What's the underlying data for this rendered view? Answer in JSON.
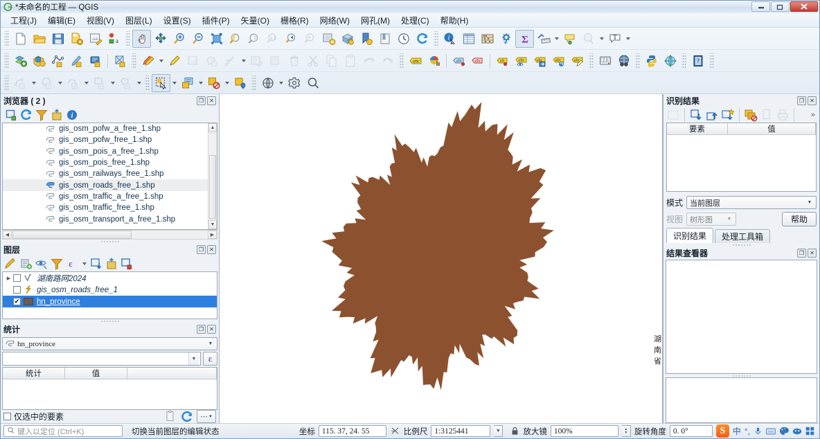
{
  "window": {
    "title": "*未命名的工程 — QGIS",
    "logo_icon": "qgis-logo-icon",
    "minimize_label": "—",
    "restore_label": "❐",
    "close_label": "✕"
  },
  "menubar": {
    "items": [
      {
        "label": "工程(J)",
        "name": "menu-project"
      },
      {
        "label": "编辑(E)",
        "name": "menu-edit"
      },
      {
        "label": "视图(V)",
        "name": "menu-view"
      },
      {
        "label": "图层(L)",
        "name": "menu-layer"
      },
      {
        "label": "设置(S)",
        "name": "menu-settings"
      },
      {
        "label": "插件(P)",
        "name": "menu-plugins"
      },
      {
        "label": "矢量(O)",
        "name": "menu-vector"
      },
      {
        "label": "栅格(R)",
        "name": "menu-raster"
      },
      {
        "label": "网络(W)",
        "name": "menu-web"
      },
      {
        "label": "网孔(M)",
        "name": "menu-mesh"
      },
      {
        "label": "处理(C)",
        "name": "menu-processing"
      },
      {
        "label": "帮助(H)",
        "name": "menu-help"
      }
    ]
  },
  "browser_panel": {
    "title": "浏览器 ( 2 )",
    "toolbar": [
      "collapse-all-icon",
      "refresh-icon",
      "filter-icon",
      "add-layer-icon",
      "info-icon"
    ],
    "items": [
      {
        "label": "gis_osm_pofw_a_free_1.shp",
        "selected": false
      },
      {
        "label": "gis_osm_pofw_free_1.shp",
        "selected": false
      },
      {
        "label": "gis_osm_pois_a_free_1.shp",
        "selected": false
      },
      {
        "label": "gis_osm_pois_free_1.shp",
        "selected": false
      },
      {
        "label": "gis_osm_railways_free_1.shp",
        "selected": false
      },
      {
        "label": "gis_osm_roads_free_1.shp",
        "selected": true
      },
      {
        "label": "gis_osm_traffic_a_free_1.shp",
        "selected": false
      },
      {
        "label": "gis_osm_traffic_free_1.shp",
        "selected": false
      },
      {
        "label": "gis_osm_transport_a_free_1.shp",
        "selected": false
      }
    ]
  },
  "layers_panel": {
    "title": "图层",
    "toolbar": [
      "open-layer-styling-icon",
      "add-group-icon",
      "manage-visibility-icon",
      "filter-legend-icon",
      "expression-filter-icon",
      "expand-all-icon",
      "collapse-all-icon",
      "remove-layer-icon"
    ],
    "layers": [
      {
        "label": "湖南路网2024",
        "checked": false,
        "selected": false,
        "symbol": "line-v-icon",
        "expandable": true
      },
      {
        "label": "gis_osm_roads_free_1",
        "checked": false,
        "selected": false,
        "symbol": "line-zigzag-icon",
        "expandable": false
      },
      {
        "label": "hn_province",
        "checked": true,
        "selected": true,
        "symbol": "polygon-swatch",
        "swatch_color": "#6d5b55",
        "expandable": false
      }
    ]
  },
  "statistics_panel": {
    "title": "统计",
    "layer_value": "hn_province",
    "layer_icon": "polygon-layer-icon",
    "expression_value": "",
    "expression_button_label": "ε",
    "columns": [
      "统计",
      "值"
    ],
    "rows": [],
    "only_selected_label": "仅选中的要素",
    "only_selected_checked": false,
    "footer_icons": [
      "copy-icon",
      "refresh-icon",
      "options-icon"
    ]
  },
  "map": {
    "label": "湖南省",
    "fill_color": "#8c5230",
    "background_color": "#ffffff"
  },
  "identify_panel": {
    "title": "识别结果",
    "toolbar": [
      "expand-new-icon",
      "expand-all-icon",
      "collapse-all-icon",
      "highlight-icon",
      "clear-results-icon",
      "copy-icon",
      "print-icon"
    ],
    "more_label": "»",
    "columns": [
      "要素",
      "值"
    ],
    "rows": [],
    "mode_label": "模式",
    "mode_value": "当前图层",
    "view_label": "视图",
    "view_value": "树形图",
    "help_label": "帮助",
    "tabs": [
      {
        "label": "识别结果",
        "active": true
      },
      {
        "label": "处理工具箱",
        "active": false
      }
    ]
  },
  "results_panel": {
    "title": "结果查看器"
  },
  "statusbar": {
    "locator_placeholder": "键入以定位 (Ctrl+K)",
    "locator_icon": "search-icon",
    "hint": "切换当前图层的编辑状态",
    "coord_label": "坐标",
    "coord_value": "115. 37, 24. 55",
    "toggle_extents_icon": "extents-toggle-icon",
    "scale_label": "比例尺",
    "scale_value": "1:3125441",
    "lock_icon": "lock-icon",
    "magnifier_label": "放大镜",
    "magnifier_value": "100%",
    "rotation_label": "旋转角度",
    "rotation_value": "0. 0°",
    "ime": {
      "logo_label": "S",
      "mode_label": "中",
      "punct_label": "°,",
      "icons": [
        "mic-icon",
        "keyboard-icon",
        "palette-icon",
        "emoji-icon",
        "toolbox-icon"
      ]
    }
  },
  "toolbars": {
    "row1": [
      "new-project-icon",
      "open-project-icon",
      "save-project-icon",
      "save-project-as-icon",
      "new-print-layout-icon",
      "style-manager-icon",
      "pan-map-icon",
      "pan-to-selection-icon",
      "zoom-in-icon",
      "zoom-out-icon",
      "zoom-full-icon",
      "zoom-to-selection-icon",
      "zoom-to-layer-icon",
      "zoom-native-icon",
      "zoom-last-icon",
      "zoom-next-icon",
      "new-map-view-icon",
      "new-3d-view-icon",
      "new-bookmark-icon",
      "show-bookmarks-icon",
      "temporal-controller-icon",
      "refresh-icon",
      "identify-features-icon",
      "attribute-table-icon",
      "statistics-icon",
      "processing-icon",
      "field-calculator-icon",
      "measure-line-icon",
      "map-tips-icon",
      "select-value-icon",
      "text-annotation-icon"
    ],
    "row2": [
      "add-vector-layer-icon",
      "add-raster-layer-icon",
      "add-delimited-text-icon",
      "add-spatialite-icon",
      "add-virtual-layer-icon",
      "add-mesh-layer-icon",
      "current-edits-icon",
      "toggle-editing-icon",
      "save-layer-edits-icon",
      "add-feature-icon",
      "vertex-tool-icon",
      "modify-attributes-icon",
      "multi-edit-icon",
      "delete-selected-icon",
      "cut-features-icon",
      "copy-features-icon",
      "paste-features-icon",
      "undo-icon",
      "redo-icon",
      "label-icon",
      "diagram-icon",
      "pin-labels-icon",
      "highlight-labels-icon",
      "move-label-icon",
      "show-hidden-labels-icon",
      "move-label-pin-icon",
      "rotate-label-icon",
      "change-label-icon",
      "python-console-old-icon",
      "metasearch-icon",
      "python-icon",
      "georeferencer-icon",
      "help-contents-icon"
    ],
    "row3": [
      "digitize-line-icon",
      "digitize-circle-icon",
      "digitize-curve-icon",
      "digitize-rect-icon",
      "digitize-polygon-icon",
      "select-features-icon",
      "select-by-form-icon",
      "deselect-all-icon",
      "select-by-location-icon",
      "web-icon",
      "settings-icon",
      "search-icon"
    ]
  }
}
